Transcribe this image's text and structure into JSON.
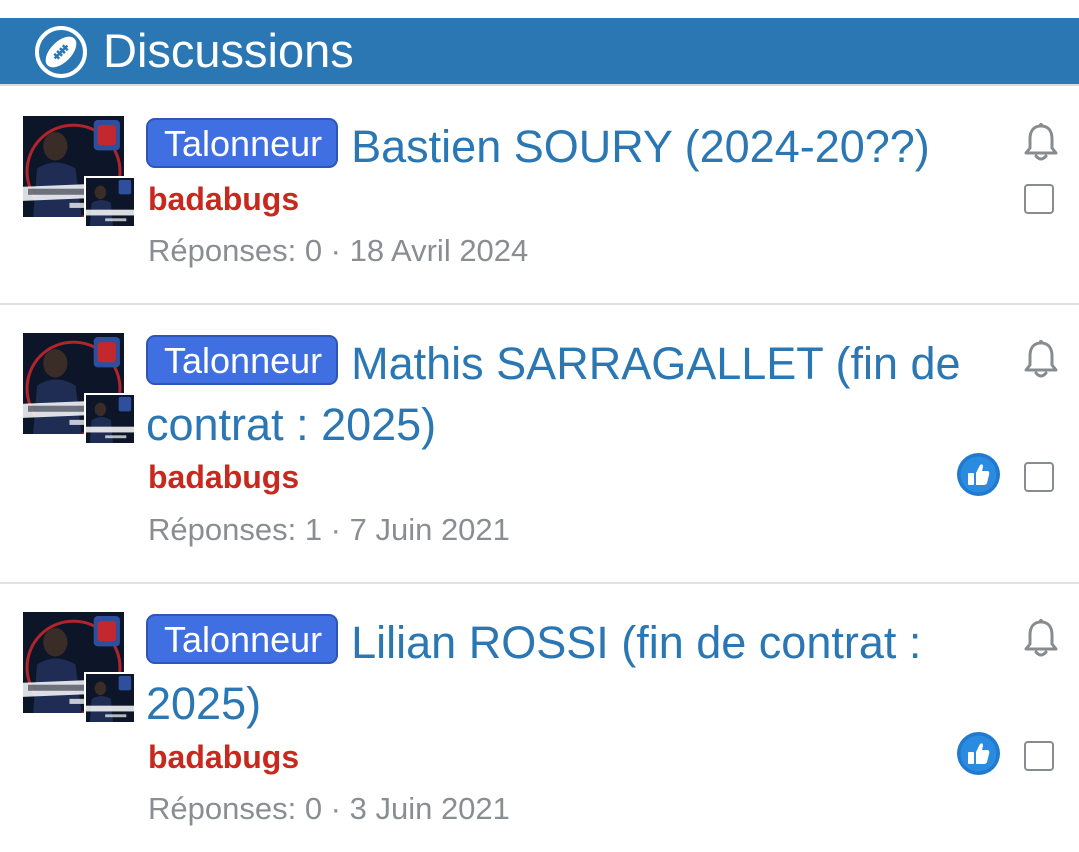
{
  "header": {
    "title": "Discussions",
    "icon": "football-icon"
  },
  "colors": {
    "header_bg": "#2a77b3",
    "link": "#2a77b3",
    "prefix_bg": "#3f6fe0",
    "author": "#c8291e",
    "meta": "#8a8e92"
  },
  "threads": [
    {
      "prefix": "Talonneur",
      "title": "Bastien SOURY (2024-20??)",
      "author": "badabugs",
      "meta": "Réponses: 0 · 18 Avril 2024",
      "liked": false
    },
    {
      "prefix": "Talonneur",
      "title": "Mathis SARRAGALLET (fin de contrat : 2025)",
      "author": "badabugs",
      "meta": "Réponses: 1 · 7 Juin 2021",
      "liked": true
    },
    {
      "prefix": "Talonneur",
      "title": "Lilian ROSSI (fin de contrat : 2025)",
      "author": "badabugs",
      "meta": "Réponses: 0 · 3 Juin 2021",
      "liked": true
    }
  ]
}
